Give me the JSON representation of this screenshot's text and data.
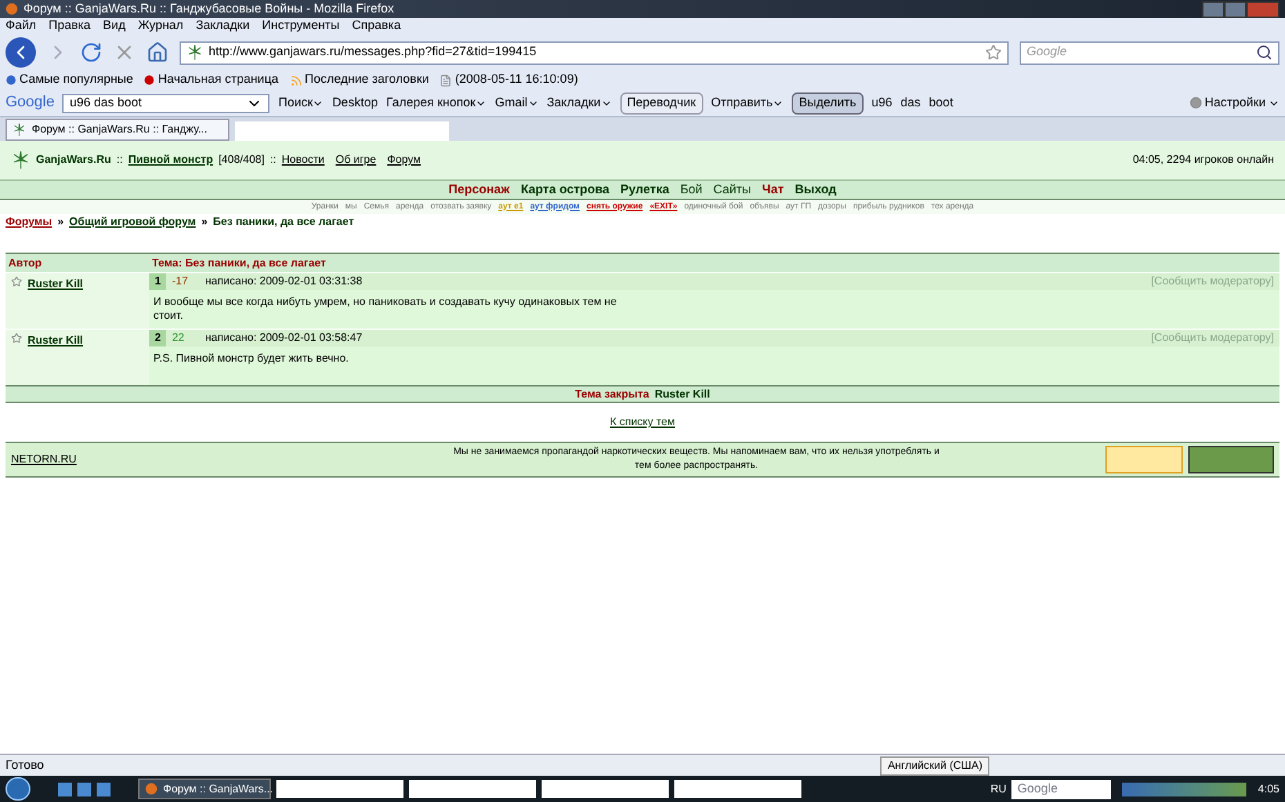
{
  "window": {
    "title": "Форум :: GanjaWars.Ru :: Ганджубасовые Войны - Mozilla Firefox"
  },
  "menu": [
    "Файл",
    "Правка",
    "Вид",
    "Журнал",
    "Закладки",
    "Инструменты",
    "Справка"
  ],
  "nav": {
    "url": "http://www.ganjawars.ru/messages.php?fid=27&tid=199415",
    "search_placeholder": "Google"
  },
  "bookmarks": [
    "Самые популярные",
    "Начальная страница",
    "Последние заголовки",
    "(2008-05-11 16:10:09)"
  ],
  "google_toolbar": {
    "logo": "Google",
    "query": "u96 das boot",
    "items": [
      {
        "label": "Поиск",
        "kind": "menu"
      },
      {
        "label": "Desktop",
        "kind": "plain"
      },
      {
        "label": "Галерея кнопок",
        "kind": "menu"
      },
      {
        "label": "Gmail",
        "kind": "menu"
      },
      {
        "label": "Закладки",
        "kind": "menu"
      },
      {
        "label": "Переводчик",
        "kind": "toggle",
        "selected": false
      },
      {
        "label": "Отправить",
        "kind": "menu"
      },
      {
        "label": "Выделить",
        "kind": "toggle",
        "selected": true
      },
      {
        "label": "u96",
        "kind": "word"
      },
      {
        "label": "das",
        "kind": "word"
      },
      {
        "label": "boot",
        "kind": "word"
      }
    ],
    "settings": "Настройки"
  },
  "tabs": [
    {
      "label": "Форум :: GanjaWars.Ru :: Ганджу...",
      "selected": true
    }
  ],
  "site": {
    "logo": "GanjaWars.Ru",
    "separator": "::",
    "user": "Пивной монстр",
    "hp": "[408/408]",
    "links": [
      "Новости",
      "Об игре",
      "Форум"
    ],
    "status": "04:05, 2294 игроков онлайн"
  },
  "main_nav": [
    {
      "label": "Персонаж",
      "kind": "strong",
      "color": "#990000"
    },
    {
      "label": "Карта острова",
      "kind": "strong",
      "color": "#003300"
    },
    {
      "label": "Рулетка",
      "kind": "strong",
      "color": "#003300"
    },
    {
      "label": "Бой",
      "kind": "plain",
      "color": "#003300"
    },
    {
      "label": "Сайты",
      "kind": "plain",
      "color": "#003300"
    },
    {
      "label": "Чат",
      "kind": "strong",
      "color": "#990000"
    },
    {
      "label": "Выход",
      "kind": "strong",
      "color": "#003300"
    }
  ],
  "sub_links": [
    {
      "label": "Уранки",
      "color": "#777777"
    },
    {
      "label": "мы",
      "color": "#777777"
    },
    {
      "label": "Семья",
      "color": "#777777"
    },
    {
      "label": "аренда",
      "color": "#777777"
    },
    {
      "label": "отозвать заявку",
      "color": "#777777"
    },
    {
      "label": "аут е1",
      "color": "#cc9900"
    },
    {
      "label": "аут фридом",
      "color": "#3366cc"
    },
    {
      "label": "снять оружие",
      "color": "#cc0000"
    },
    {
      "label": "«EXIT»",
      "color": "#cc0000"
    },
    {
      "label": "одиночный бой",
      "color": "#777777"
    },
    {
      "label": "объявы",
      "color": "#777777"
    },
    {
      "label": "аут ГП",
      "color": "#777777"
    },
    {
      "label": "дозоры",
      "color": "#777777"
    },
    {
      "label": "прибыль рудников",
      "color": "#777777"
    },
    {
      "label": "тех аренда",
      "color": "#777777"
    }
  ],
  "breadcrumb": [
    "Форумы",
    "Общий игровой форум",
    "Без паники, да все лагает"
  ],
  "breadcrumb_separator": "»",
  "table": {
    "columns": [
      "Автор",
      "Тема: Без паники, да все лагает"
    ],
    "posts": [
      {
        "author": "Ruster Kill",
        "number": "1",
        "score": "-17",
        "color": "#993300",
        "date": "написано: 2009-02-01 03:31:38",
        "report": "[Сообщить модератору]",
        "text": "И вообще мы все когда нибуть умрем, но паниковать и создавать кучу одинаковых тем не стоит."
      },
      {
        "author": "Ruster Kill",
        "number": "2",
        "score": "22",
        "color": "#339933",
        "date": "написано: 2009-02-01 03:58:47",
        "report": "[Сообщить модератору]",
        "text": "P.S. Пивной монстр будет жить вечно."
      }
    ],
    "closed": {
      "label": "Тема закрыта",
      "user": "Ruster Kill"
    }
  },
  "back_link": "К списку тем",
  "footer": {
    "link": "NETORN.RU",
    "disclaimer": "Мы не занимаемся пропагандой наркотических веществ. Мы напоминаем вам, что их нельзя употреблять и тем более распространять."
  },
  "status_bar": {
    "text": "Готово",
    "tooltip": "Английский (США)"
  },
  "taskbar": {
    "window": "Форум :: GanjaWars...",
    "lang": "RU",
    "search_placeholder": "Google",
    "clock": "4:05"
  }
}
